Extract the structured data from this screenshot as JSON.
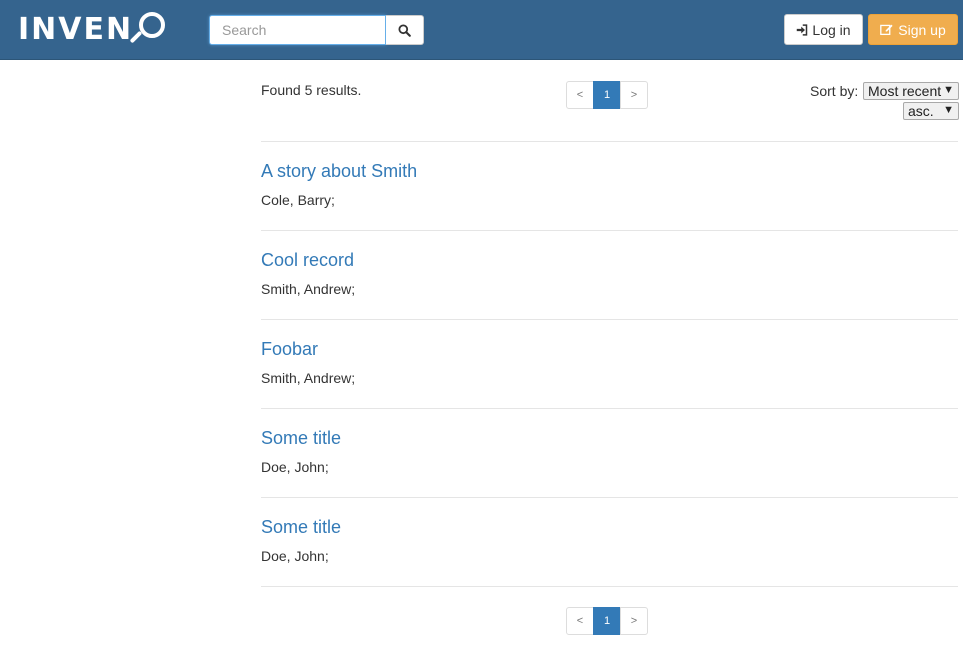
{
  "header": {
    "logo_text": "INVEN",
    "logo_alt": "INVENIO",
    "search_placeholder": "Search",
    "login_label": "Log in",
    "signup_label": "Sign up"
  },
  "colors": {
    "navbar": "#35648e",
    "link": "#337ab7",
    "signup": "#f0ad4e"
  },
  "icons": {
    "search": "search-icon",
    "login": "sign-in-icon",
    "signup": "edit-icon"
  },
  "results": {
    "found_text": "Found 5 results.",
    "sort_label": "Sort by:",
    "sort_selected": "Most recent",
    "order_selected": "asc.",
    "pagination": {
      "prev": "<",
      "current": "1",
      "next": ">"
    },
    "records": [
      {
        "title": "A story about Smith",
        "authors": "Cole, Barry;"
      },
      {
        "title": "Cool record",
        "authors": "Smith, Andrew;"
      },
      {
        "title": "Foobar",
        "authors": "Smith, Andrew;"
      },
      {
        "title": "Some title",
        "authors": "Doe, John;"
      },
      {
        "title": "Some title",
        "authors": "Doe, John;"
      }
    ]
  }
}
